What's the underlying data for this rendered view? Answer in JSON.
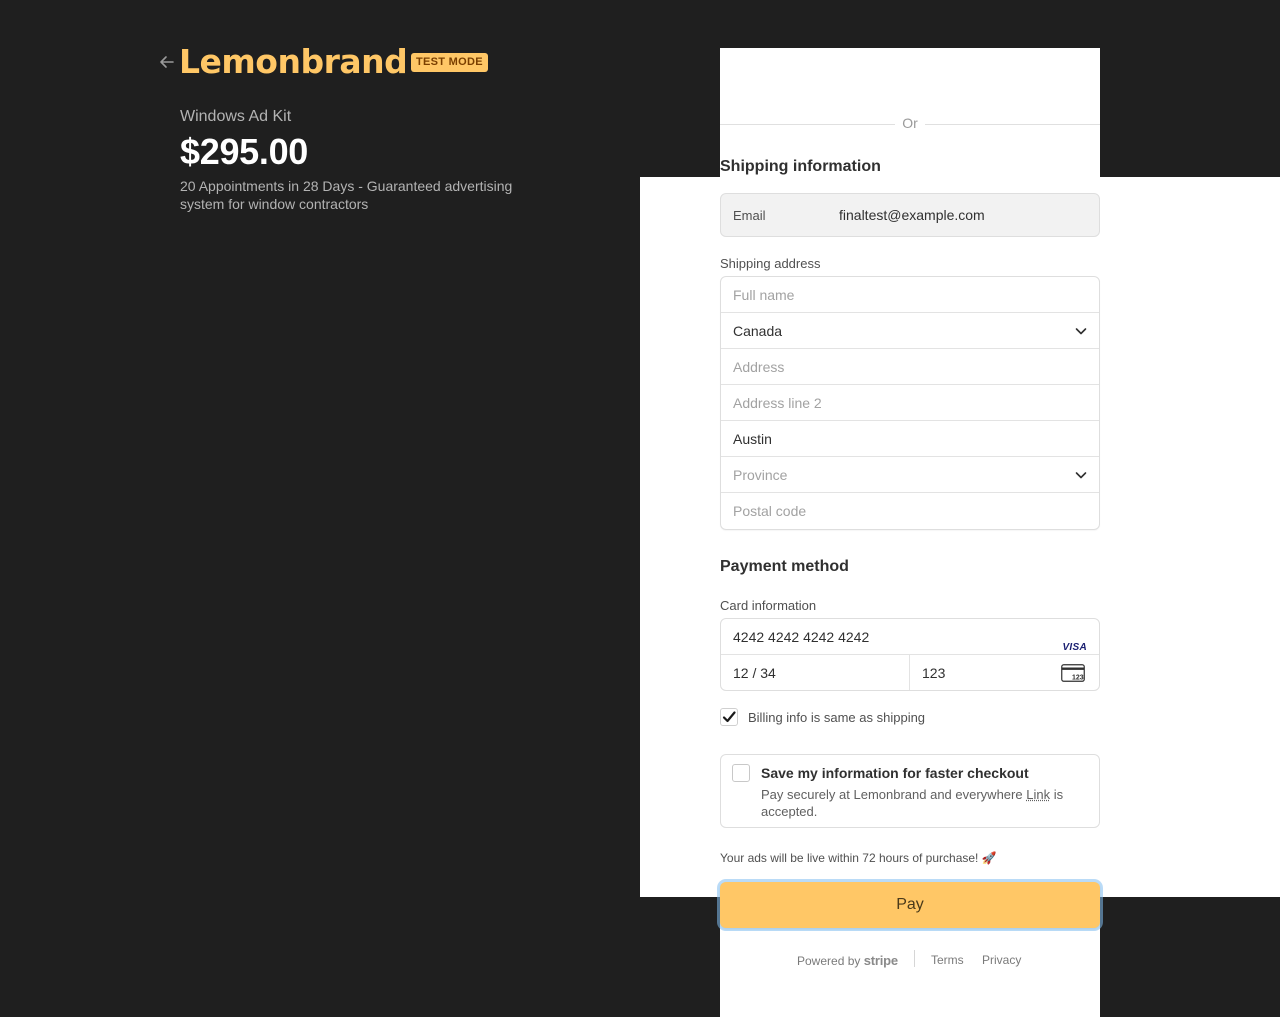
{
  "header": {
    "brand": "Lemonbrand",
    "badge": "TEST MODE"
  },
  "product": {
    "name": "Windows Ad Kit",
    "price": "$295.00",
    "description": "20 Appointments in 28 Days - Guaranteed advertising system for window contractors"
  },
  "divider": {
    "text": "Or"
  },
  "shipping": {
    "title": "Shipping information",
    "email_label": "Email",
    "email_value": "finaltest@example.com",
    "address_label": "Shipping address",
    "full_name_placeholder": "Full name",
    "country_value": "Canada",
    "address_placeholder": "Address",
    "address2_placeholder": "Address line 2",
    "city_value": "Austin",
    "province_placeholder": "Province",
    "postal_placeholder": "Postal code"
  },
  "payment": {
    "title": "Payment method",
    "card_label": "Card information",
    "card_number": "4242 4242 4242 4242",
    "card_brand": "VISA",
    "expiry": "12 / 34",
    "cvc": "123",
    "cvc_icon_text": "123",
    "billing_same": "Billing info is same as shipping",
    "billing_checked": true
  },
  "save_info": {
    "title": "Save my information for faster checkout",
    "subtitle": "Pay securely at Lemonbrand and everywhere",
    "link": "Link",
    "subtitle_end": "is accepted.",
    "checked": false
  },
  "notice": "Your ads will be live within 72 hours of purchase! 🚀",
  "pay_label": "Pay",
  "footer": {
    "powered": "Powered by",
    "stripe": "stripe",
    "terms": "Terms",
    "privacy": "Privacy"
  },
  "colors": {
    "background": "#1f1f1f",
    "brand": "#ffc766",
    "pay_button": "#ffc766",
    "panel": "#ffffff"
  },
  "icons": [
    "back-arrow-icon",
    "chevron-down-icon",
    "visa-icon",
    "cvc-card-icon",
    "checkmark-icon",
    "rocket-emoji"
  ]
}
